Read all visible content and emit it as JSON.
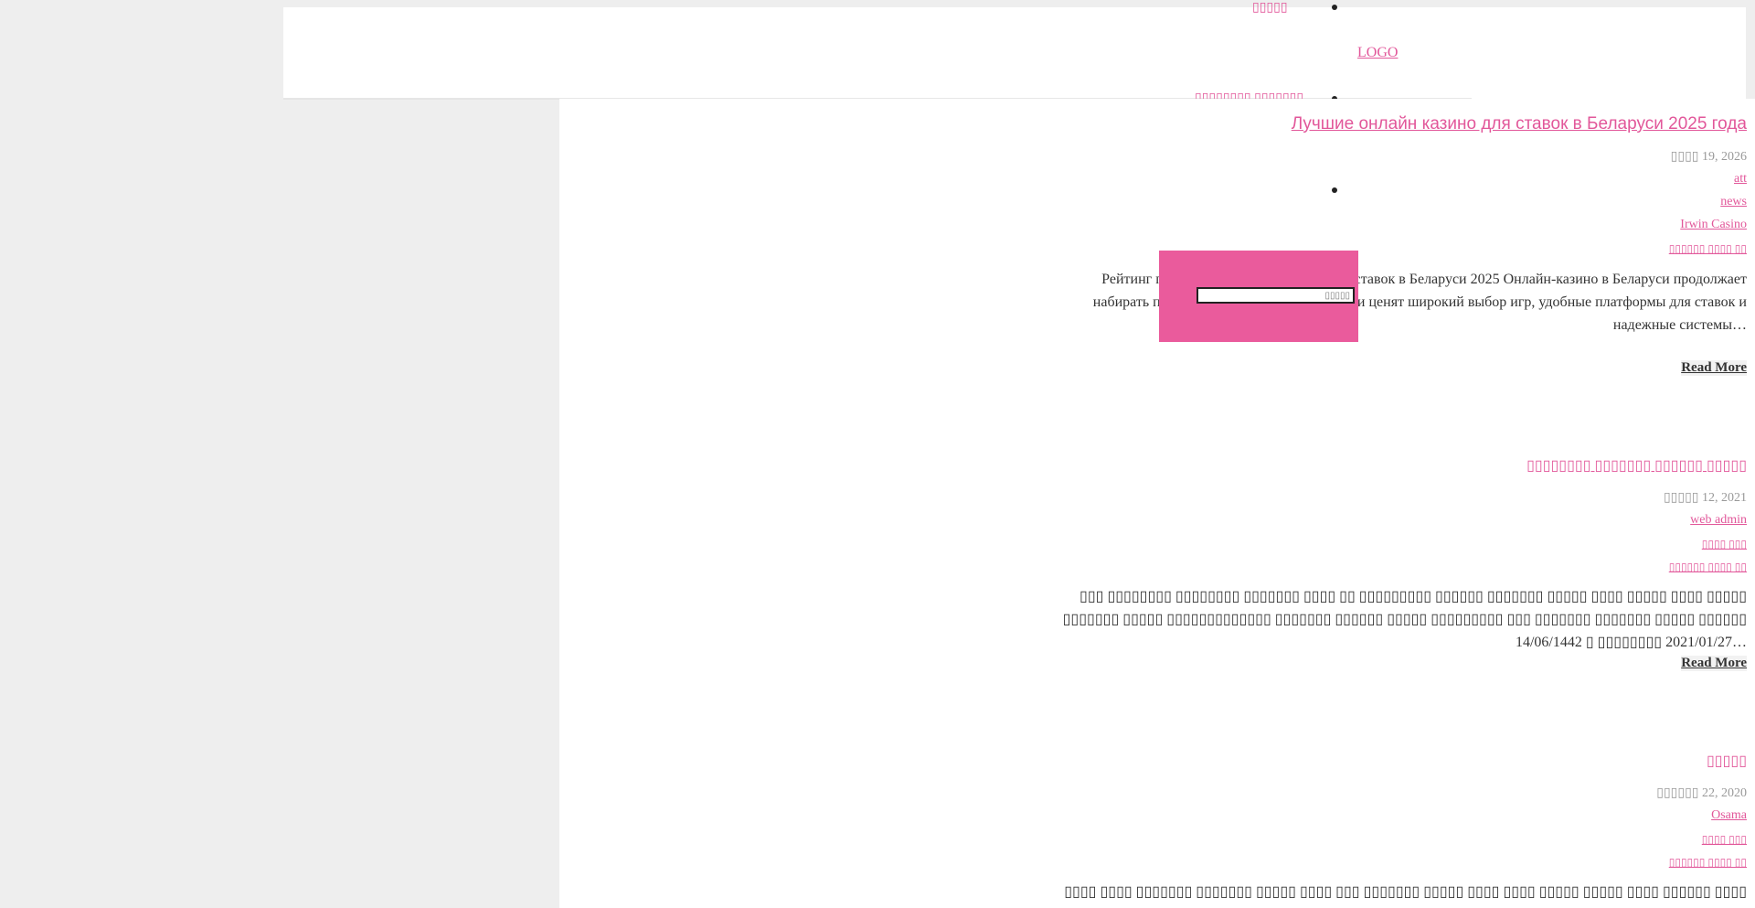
{
  "header": {
    "nav_top": "▯▯▯▯▯",
    "logo": "LOGO",
    "nav_bottom": "▯▯▯▯▯▯▯▯ ▯▯▯▯▯▯▯"
  },
  "search": {
    "placeholder": "▯▯▯▯▯"
  },
  "posts": [
    {
      "title": "Лучшие онлайн казино для ставок в Беларуси 2025 года",
      "date": "▯▯▯▯ 19, 2026",
      "author": "att",
      "category": "news",
      "tag": "Irwin Casino",
      "comments": "▯▯▯▯▯▯ ▯▯▯▯ ▯▯",
      "excerpt": "Рейтинг популярных онлайн казино для ставок в Беларуси 2025 Онлайн-казино в Беларуси продолжает набирать популярность в 2025 году. Игроки ценят широкий выбор игр, удобные платформы для ставок и надежные системы…",
      "read_more": "Read More"
    },
    {
      "title": "▯▯▯▯▯▯▯▯ ▯▯▯▯▯▯▯ ▯▯▯▯▯▯ ▯▯▯▯▯",
      "date": "▯▯▯▯▯ 12, 2021",
      "author": "web admin",
      "category": "▯▯▯▯ ▯▯▯",
      "comments": "▯▯▯▯▯▯ ▯▯▯▯ ▯▯",
      "excerpt": "▯▯▯ ▯▯▯▯▯▯▯▯ ▯▯▯▯▯▯▯▯ ▯▯▯▯▯▯▯ ▯▯▯▯ ▯▯ ▯▯▯▯▯▯▯▯▯ ▯▯▯▯▯▯ ▯▯▯▯▯▯▯ ▯▯▯▯▯ ▯▯▯▯ ▯▯▯▯▯ ▯▯▯▯ ▯▯▯▯▯ ▯▯▯▯▯▯▯ ▯▯▯▯▯ ▯▯▯▯▯▯▯▯▯▯▯▯▯ ▯▯▯▯▯▯▯ ▯▯▯▯▯▯ ▯▯▯▯▯ ▯▯▯▯▯▯▯▯▯ ▯▯▯ ▯▯▯▯▯▯▯ ▯▯▯▯▯▯▯ ▯▯▯▯▯ ▯▯▯▯▯▯ 14/06/1442 ▯ ▯▯▯▯▯▯▯▯ 2021/01/27…",
      "read_more": "Read More"
    },
    {
      "title": "▯▯▯▯▯",
      "date": "▯▯▯▯▯▯ 22, 2020",
      "author": "Osama",
      "category": "▯▯▯▯ ▯▯▯",
      "comments": "▯▯▯▯▯▯ ▯▯▯▯ ▯▯",
      "excerpt": "▯▯▯▯ ▯▯▯▯ ▯▯▯▯▯▯▯ ▯▯▯▯▯▯▯ ▯▯▯▯▯ ▯▯▯▯ ▯▯▯ ▯▯▯▯▯▯▯ ▯▯▯▯▯ ▯▯▯▯ ▯▯▯▯ ▯▯▯▯▯ ▯▯▯▯▯ ▯▯▯▯ ▯▯▯▯▯▯ ▯▯▯▯ ▯▯▯▯▯ ▯▯▯▯▯ ▯▯▯▯▯▯▯▯▯▯▯▯ ▯▯▯▯ ▯▯▯▯ ▯▯▯ ▯▯▯▯▯▯▯▯"
    }
  ]
}
